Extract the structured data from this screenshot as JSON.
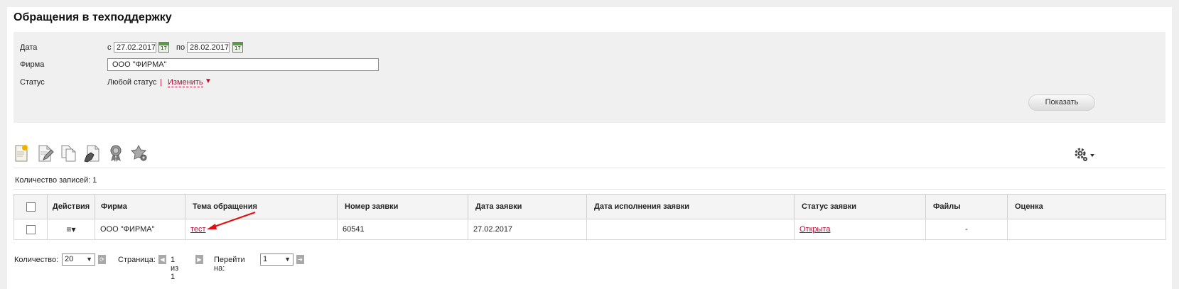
{
  "page": {
    "title": "Обращения в техподдержку"
  },
  "filter": {
    "date_label": "Дата",
    "from_prefix": "с",
    "date_from": "27.02.2017",
    "to_prefix": "по",
    "date_to": "28.02.2017",
    "calendar_day": "17",
    "firm_label": "Фирма",
    "firm_value": "ООО \"ФИРМА\"",
    "status_label": "Статус",
    "status_value": "Любой статус",
    "status_sep": "|",
    "change_link": "Изменить",
    "change_arrow": "▼",
    "show_button": "Показать"
  },
  "toolbar": {
    "icons": [
      "new-document-icon",
      "edit-document-icon",
      "copy-document-icon",
      "sign-document-icon",
      "award-icon",
      "star-settings-icon"
    ],
    "settings_icon": "gear-icon"
  },
  "records": {
    "count_label": "Количество записей: 1"
  },
  "table": {
    "headers": {
      "actions": "Действия",
      "firm": "Фирма",
      "subject": "Тема обращения",
      "number": "Номер заявки",
      "date": "Дата заявки",
      "exec_date": "Дата исполнения заявки",
      "status": "Статус заявки",
      "files": "Файлы",
      "rating": "Оценка"
    },
    "rows": [
      {
        "actions_icon": "≡▾",
        "firm": "ООО \"ФИРМА\"",
        "subject": "тест",
        "number": "60541",
        "date": "27.02.2017",
        "exec_date": "",
        "status": "Открыта",
        "files": "-",
        "rating": ""
      }
    ]
  },
  "pager": {
    "qty_label": "Количество:",
    "qty_value": "20",
    "page_label": "Страница:",
    "page_info": "1 из 1",
    "goto_label": "Перейти на:",
    "goto_value": "1"
  },
  "colors": {
    "link": "#b0103a",
    "filter_bg": "#f0f0f0",
    "arrow": "#e01010"
  }
}
